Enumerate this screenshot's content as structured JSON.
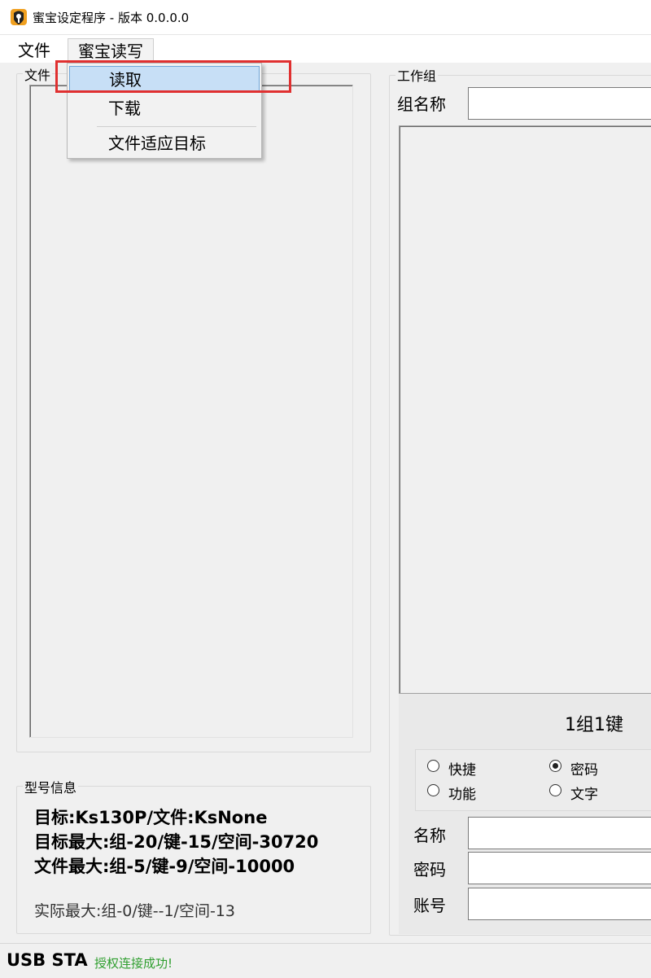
{
  "window": {
    "title": "蜜宝设定程序 - 版本 0.0.0.0",
    "icon": "app-logo-icon"
  },
  "menubar": {
    "file_label": "文件",
    "readwrite_label": "蜜宝读写"
  },
  "dropdown": {
    "items": [
      "读取",
      "下载",
      "文件适应目标"
    ],
    "selected_index": 0
  },
  "file_group": {
    "label": "文件"
  },
  "model_info": {
    "label": "型号信息",
    "target": "目标:Ks130P/文件:KsNone",
    "target_max": "目标最大:组-20/键-15/空间-30720",
    "file_max": "文件最大:组-5/键-9/空间-10000",
    "actual_max": "实际最大:组-0/键--1/空间-13"
  },
  "work_group": {
    "label": "工作组",
    "group_name_label": "组名称",
    "group_name_value": "",
    "count_text": "1组1键",
    "radios": [
      {
        "label": "快捷",
        "checked": false
      },
      {
        "label": "密码",
        "checked": true
      },
      {
        "label": "功能",
        "checked": false
      },
      {
        "label": "文字",
        "checked": false
      }
    ],
    "name_label": "名称",
    "password_label": "密码",
    "account_label": "账号"
  },
  "statusbar": {
    "usb_label": "USB STA",
    "message": "授权连接成功!",
    "message_color": "#2e9e2e"
  },
  "colors": {
    "highlight": "#e03030",
    "menu_selected": "#c7dff6"
  }
}
